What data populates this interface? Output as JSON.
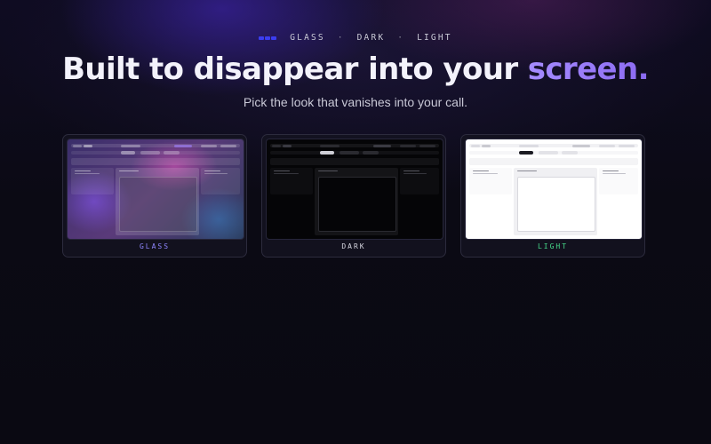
{
  "eyebrow": {
    "items": [
      "GLASS",
      "DARK",
      "LIGHT"
    ],
    "separator": "·"
  },
  "headline": {
    "main": "Built to disappear into your ",
    "accent": "screen."
  },
  "subtitle": "Pick the look that vanishes into your call.",
  "themes": [
    {
      "id": "glass",
      "label": "GLASS",
      "label_color": "#8f86ff"
    },
    {
      "id": "dark",
      "label": "DARK",
      "label_color": "#d6d6e0"
    },
    {
      "id": "light",
      "label": "LIGHT",
      "label_color": "#46d98a"
    }
  ],
  "colors": {
    "accent": "#9a7cff",
    "eyebrow_dots": "#3b3df0",
    "background": "#0b0a14"
  }
}
